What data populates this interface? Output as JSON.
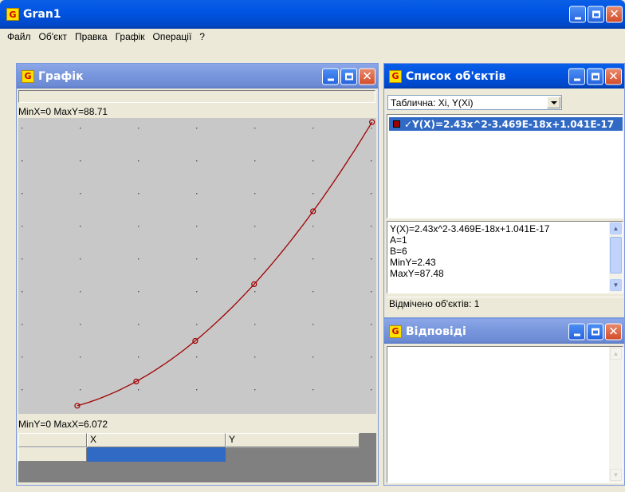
{
  "app": {
    "title": "Gran1",
    "icon_letter": "G"
  },
  "menu": [
    "Файл",
    "Об'єкт",
    "Правка",
    "Графік",
    "Операції",
    "?"
  ],
  "graph_window": {
    "title": "Графік",
    "top_info": "MinX=0  MaxY=88.71",
    "bottom_info": "MinY=0  MaxX=6.072",
    "table_headers": [
      "X",
      "Y"
    ],
    "curve_color": "#a00000",
    "plot_bg": "#c8c8c8"
  },
  "chart_data": {
    "type": "line",
    "x_range": [
      0,
      6.072
    ],
    "y_range": [
      0,
      88.71
    ],
    "series": [
      {
        "name": "Y(X)=2.43x^2-3.469E-18x+1.041E-17",
        "x": [
          1,
          2,
          3,
          4,
          5,
          6
        ],
        "y": [
          2.43,
          9.72,
          21.87,
          38.88,
          60.75,
          87.48
        ],
        "markers": true,
        "color": "#a00000"
      }
    ],
    "grid": "dotted"
  },
  "objects_window": {
    "title": "Список об'єктів",
    "combo_value": "Таблична: Xi, Y(Xi)",
    "list_items": [
      {
        "label": "✓Y(X)=2.43x^2-3.469E-18x+1.041E-17",
        "color": "#a00000",
        "selected": true
      }
    ],
    "details": [
      "Y(X)=2.43x^2-3.469E-18x+1.041E-17",
      "A=1",
      "B=6",
      "MinY=2.43",
      "MaxY=87.48"
    ],
    "status": "Відмічено об'єктів: 1"
  },
  "answers_window": {
    "title": "Відповіді"
  }
}
